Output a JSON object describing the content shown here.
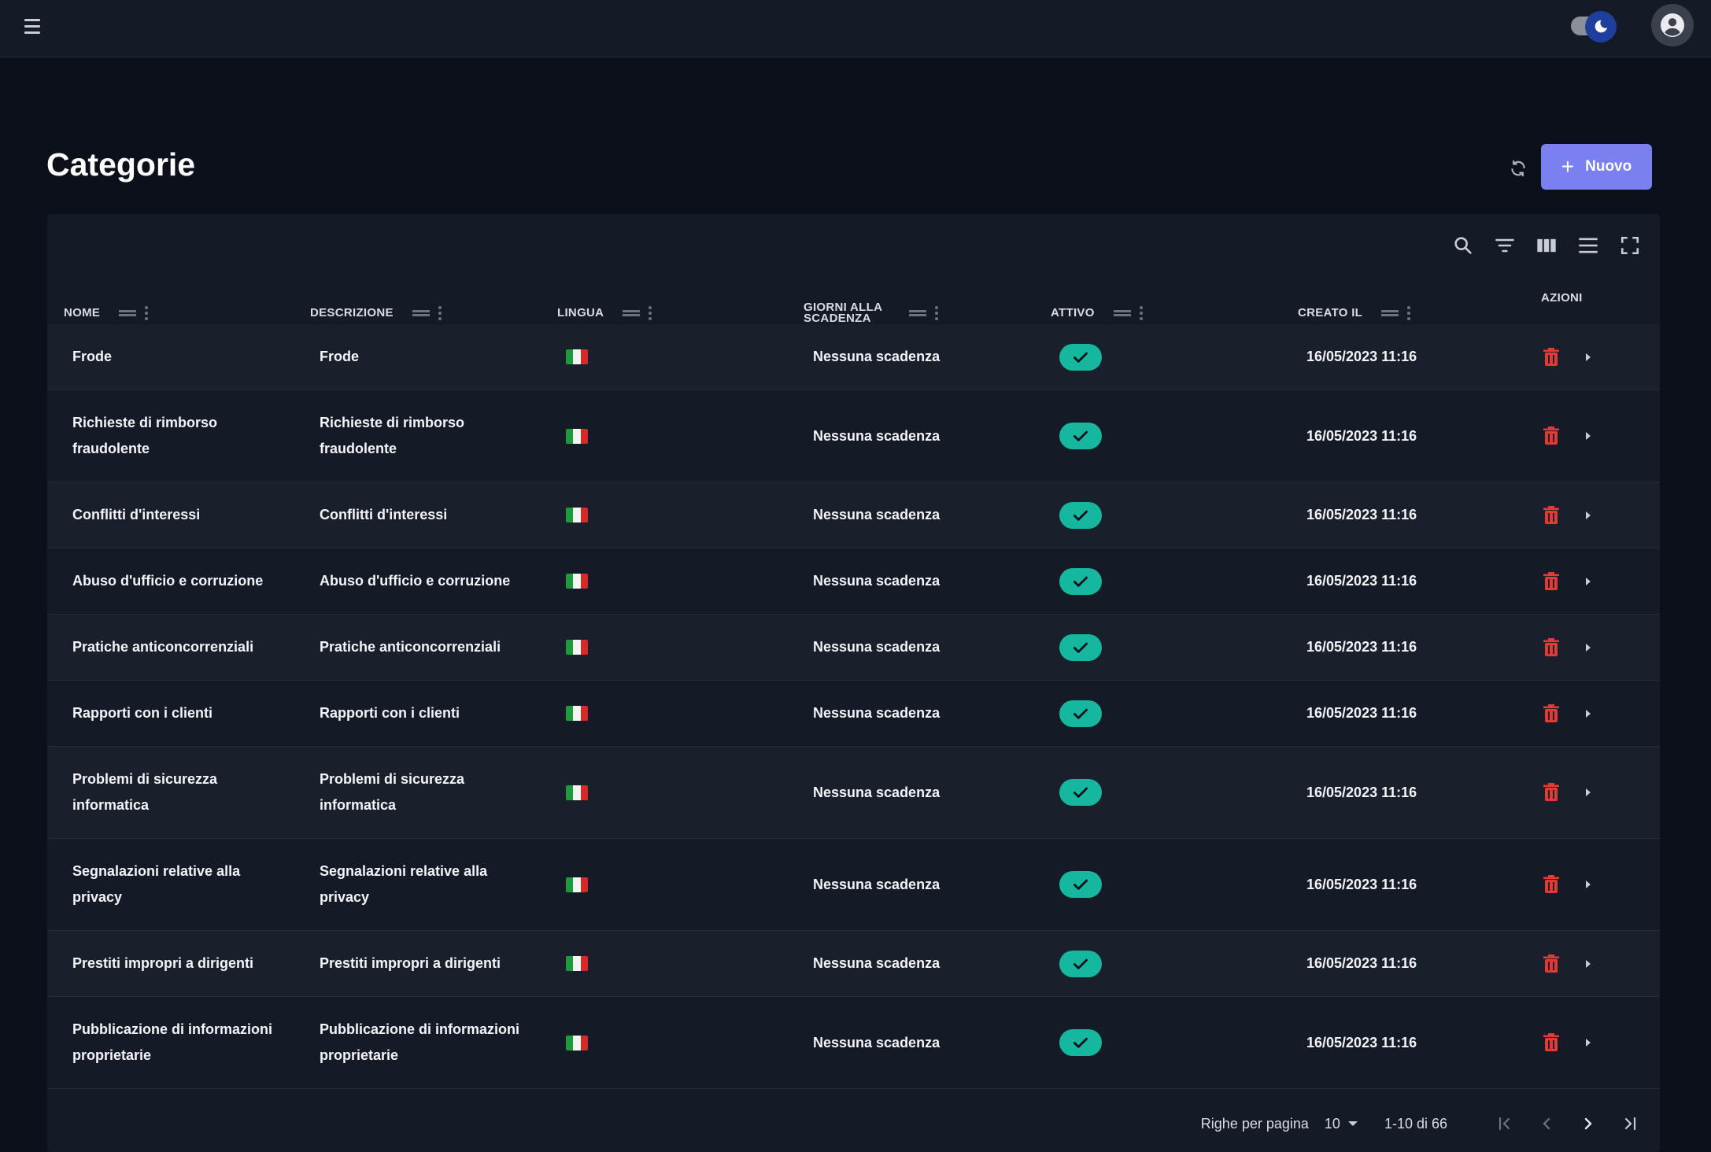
{
  "header": {
    "title": "Categorie",
    "new_button_label": "Nuovo"
  },
  "table": {
    "columns": [
      {
        "key": "nome",
        "label": "NOME"
      },
      {
        "key": "descrizione",
        "label": "DESCRIZIONE"
      },
      {
        "key": "lingua",
        "label": "LINGUA"
      },
      {
        "key": "giorni",
        "label": "GIORNI ALLA SCADENZA"
      },
      {
        "key": "attivo",
        "label": "ATTIVO"
      },
      {
        "key": "creato",
        "label": "CREATO IL"
      },
      {
        "key": "azioni",
        "label": "AZIONI"
      }
    ],
    "rows": [
      {
        "nome": "Frode",
        "descrizione": "Frode",
        "lingua": "it-flag",
        "giorni": "Nessuna scadenza",
        "attivo": true,
        "creato": "16/05/2023 11:16"
      },
      {
        "nome": "Richieste di rimborso fraudolente",
        "descrizione": "Richieste di rimborso fraudolente",
        "lingua": "it-flag",
        "giorni": "Nessuna scadenza",
        "attivo": true,
        "creato": "16/05/2023 11:16"
      },
      {
        "nome": "Conflitti d'interessi",
        "descrizione": "Conflitti d'interessi",
        "lingua": "it-flag",
        "giorni": "Nessuna scadenza",
        "attivo": true,
        "creato": "16/05/2023 11:16"
      },
      {
        "nome": "Abuso d'ufficio e corruzione",
        "descrizione": "Abuso d'ufficio e corruzione",
        "lingua": "it-flag",
        "giorni": "Nessuna scadenza",
        "attivo": true,
        "creato": "16/05/2023 11:16"
      },
      {
        "nome": "Pratiche anticoncorrenziali",
        "descrizione": "Pratiche anticoncorrenziali",
        "lingua": "it-flag",
        "giorni": "Nessuna scadenza",
        "attivo": true,
        "creato": "16/05/2023 11:16"
      },
      {
        "nome": "Rapporti con i clienti",
        "descrizione": "Rapporti con i clienti",
        "lingua": "it-flag",
        "giorni": "Nessuna scadenza",
        "attivo": true,
        "creato": "16/05/2023 11:16"
      },
      {
        "nome": "Problemi di sicurezza informatica",
        "descrizione": "Problemi di sicurezza informatica",
        "lingua": "it-flag",
        "giorni": "Nessuna scadenza",
        "attivo": true,
        "creato": "16/05/2023 11:16"
      },
      {
        "nome": "Segnalazioni relative alla privacy",
        "descrizione": "Segnalazioni relative alla privacy",
        "lingua": "it-flag",
        "giorni": "Nessuna scadenza",
        "attivo": true,
        "creato": "16/05/2023 11:16"
      },
      {
        "nome": "Prestiti impropri a dirigenti",
        "descrizione": "Prestiti impropri a dirigenti",
        "lingua": "it-flag",
        "giorni": "Nessuna scadenza",
        "attivo": true,
        "creato": "16/05/2023 11:16"
      },
      {
        "nome": "Pubblicazione di informazioni proprietarie",
        "descrizione": "Pubblicazione di informazioni proprietarie",
        "lingua": "it-flag",
        "giorni": "Nessuna scadenza",
        "attivo": true,
        "creato": "16/05/2023 11:16"
      }
    ]
  },
  "pagination": {
    "rows_per_page_label": "Righe per pagina",
    "rows_per_page_value": "10",
    "range_label": "1-10 di 66"
  },
  "icons": {
    "menu": "hamburger-icon",
    "theme": "moon-icon",
    "user": "account-circle-icon",
    "refresh": "refresh-icon",
    "add": "plus-icon",
    "search": "search-icon",
    "filter": "filter-icon",
    "columns": "columns-icon",
    "density": "density-icon",
    "fullscreen": "fullscreen-icon",
    "delete": "trash-icon",
    "expand": "chevron-right-icon"
  },
  "colors": {
    "background": "#0b101a",
    "surface": "#151b26",
    "primary": "#7b80f0",
    "active_chip": "#15b79e",
    "delete": "#e53935",
    "flag_green": "#1e9a3c",
    "flag_white": "#f4f5f0",
    "flag_red": "#d42a2a"
  }
}
